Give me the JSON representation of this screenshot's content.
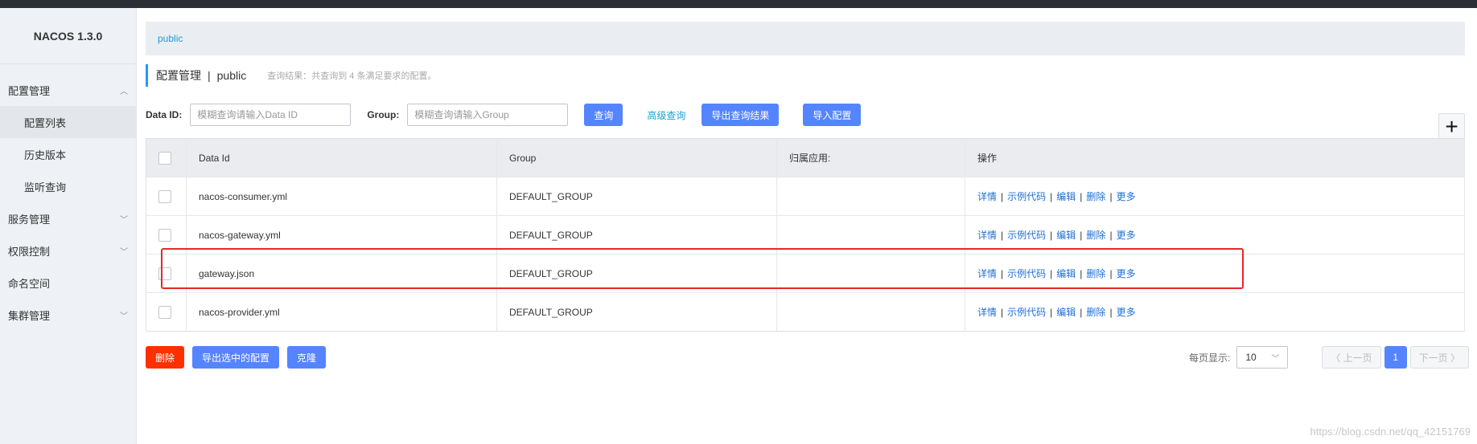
{
  "app": {
    "title": "NACOS 1.3.0"
  },
  "sidebar": {
    "items": [
      {
        "label": "配置管理",
        "open": true,
        "children": [
          {
            "label": "配置列表",
            "active": true
          },
          {
            "label": "历史版本"
          },
          {
            "label": "监听查询"
          }
        ]
      },
      {
        "label": "服务管理"
      },
      {
        "label": "权限控制"
      },
      {
        "label": "命名空间"
      },
      {
        "label": "集群管理"
      }
    ]
  },
  "namespace_bar": {
    "current": "public"
  },
  "header": {
    "title": "配置管理",
    "separator": "|",
    "namespace": "public",
    "result_text": "查询结果：共查询到 4 条满足要求的配置。"
  },
  "search": {
    "data_id_label": "Data ID:",
    "data_id_placeholder": "模糊查询请输入Data ID",
    "group_label": "Group:",
    "group_placeholder": "模糊查询请输入Group",
    "query_button": "查询",
    "advanced_link": "高级查询",
    "export_results_button": "导出查询结果",
    "import_button": "导入配置",
    "add_button": "+"
  },
  "table": {
    "columns": [
      "Data Id",
      "Group",
      "归属应用:",
      "操作"
    ],
    "rows": [
      {
        "data_id": "nacos-consumer.yml",
        "group": "DEFAULT_GROUP",
        "app": ""
      },
      {
        "data_id": "nacos-gateway.yml",
        "group": "DEFAULT_GROUP",
        "app": ""
      },
      {
        "data_id": "gateway.json",
        "group": "DEFAULT_GROUP",
        "app": ""
      },
      {
        "data_id": "nacos-provider.yml",
        "group": "DEFAULT_GROUP",
        "app": ""
      }
    ],
    "actions": [
      "详情",
      "示例代码",
      "编辑",
      "删除",
      "更多"
    ],
    "action_separator": "|"
  },
  "bulk_actions": {
    "delete_button": "删除",
    "export_selected_button": "导出选中的配置",
    "clone_button": "克隆"
  },
  "pagination": {
    "per_page_label": "每页显示:",
    "per_page_value": "10",
    "prev_label": "〈 上一页",
    "current_page": "1",
    "next_label": "下一页 〉"
  },
  "watermark": "https://blog.csdn.net/qq_42151769",
  "colors": {
    "primary": "#5584ff",
    "danger": "#ff3000",
    "link": "#1d6ed7",
    "highlight": "#e8262b"
  }
}
